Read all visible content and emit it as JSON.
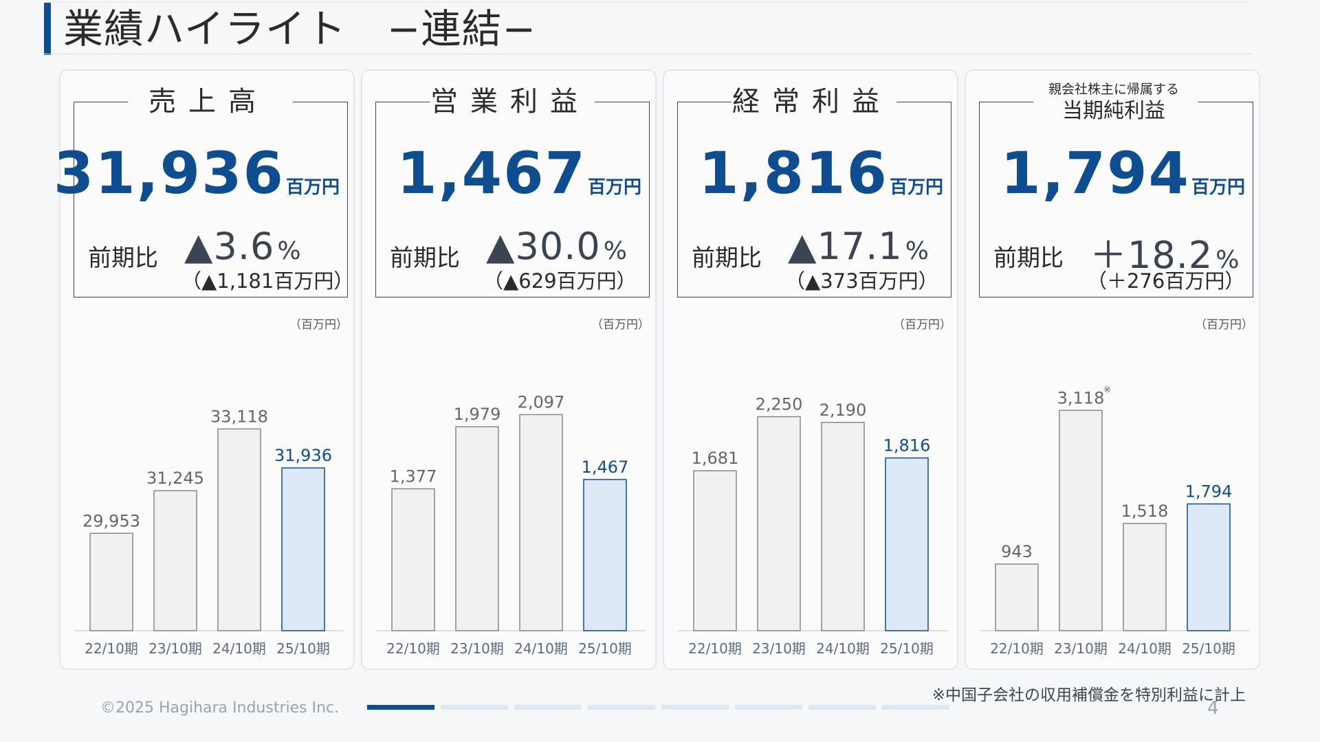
{
  "page": {
    "title": "業績ハイライト　−連結−",
    "footnote": "※中国子会社の収用補償金を特別利益に計上",
    "copyright": "©2025 Hagihara Industries Inc.",
    "page_number": "4",
    "progress": {
      "segments": 8,
      "current": 1
    }
  },
  "colors": {
    "accent": "#0e4d8f",
    "bar": "#f1f1f1",
    "bar_highlight": "#dde9f6",
    "bar_stroke": "#888888"
  },
  "cards": [
    {
      "metric": "売上高",
      "metric_sub": "",
      "value": "31,936",
      "unit": "百万円",
      "cmp_label": "前期比",
      "change_pct": "▲3.6",
      "pct_symbol": "%",
      "change_amount": "（▲1,181百万円）",
      "chart_unit": "（百万円）"
    },
    {
      "metric": "営業利益",
      "metric_sub": "",
      "value": "1,467",
      "unit": "百万円",
      "cmp_label": "前期比",
      "change_pct": "▲30.0",
      "pct_symbol": "%",
      "change_amount": "（▲629百万円）",
      "chart_unit": "（百万円）"
    },
    {
      "metric": "経常利益",
      "metric_sub": "",
      "value": "1,816",
      "unit": "百万円",
      "cmp_label": "前期比",
      "change_pct": "▲17.1",
      "pct_symbol": "%",
      "change_amount": "（▲373百万円）",
      "chart_unit": "（百万円）"
    },
    {
      "metric": "当期純利益",
      "metric_sub": "親会社株主に帰属する",
      "value": "1,794",
      "unit": "百万円",
      "cmp_label": "前期比",
      "change_pct": "＋18.2",
      "pct_symbol": "%",
      "change_amount": "（＋276百万円）",
      "chart_unit": "（百万円）"
    }
  ],
  "chart_data": [
    {
      "type": "bar",
      "categories": [
        "22/10期",
        "23/10期",
        "24/10期",
        "25/10期"
      ],
      "values": [
        29953,
        31245,
        33118,
        31936
      ],
      "labels": [
        "29,953",
        "31,245",
        "33,118",
        "31,936"
      ],
      "highlight_index": 3,
      "ylim": [
        27000,
        34500
      ],
      "annotation": ""
    },
    {
      "type": "bar",
      "categories": [
        "22/10期",
        "23/10期",
        "24/10期",
        "25/10期"
      ],
      "values": [
        1377,
        1979,
        2097,
        1467
      ],
      "labels": [
        "1,377",
        "1,979",
        "2,097",
        "1,467"
      ],
      "highlight_index": 3,
      "ylim": [
        0,
        2400
      ],
      "annotation": ""
    },
    {
      "type": "bar",
      "categories": [
        "22/10期",
        "23/10期",
        "24/10期",
        "25/10期"
      ],
      "values": [
        1681,
        2250,
        2190,
        1816
      ],
      "labels": [
        "1,681",
        "2,250",
        "2,190",
        "1,816"
      ],
      "highlight_index": 3,
      "ylim": [
        0,
        2600
      ],
      "annotation": ""
    },
    {
      "type": "bar",
      "categories": [
        "22/10期",
        "23/10期",
        "24/10期",
        "25/10期"
      ],
      "values": [
        943,
        3118,
        1518,
        1794
      ],
      "labels": [
        "943",
        "3,118",
        "1,518",
        "1,794"
      ],
      "highlight_index": 3,
      "ylim": [
        0,
        3500
      ],
      "annotation": "※",
      "annotation_index": 1
    }
  ]
}
